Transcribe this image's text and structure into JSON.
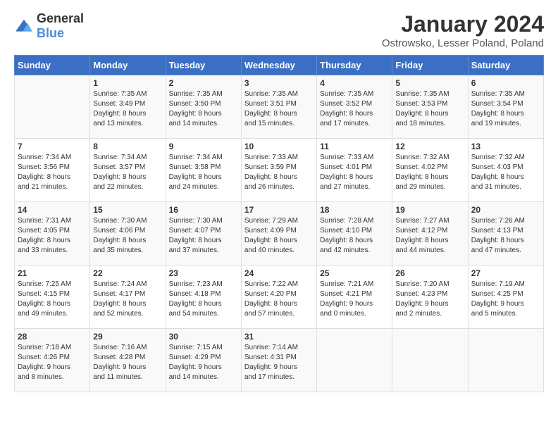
{
  "header": {
    "logo_general": "General",
    "logo_blue": "Blue",
    "title": "January 2024",
    "subtitle": "Ostrowsko, Lesser Poland, Poland"
  },
  "days_of_week": [
    "Sunday",
    "Monday",
    "Tuesday",
    "Wednesday",
    "Thursday",
    "Friday",
    "Saturday"
  ],
  "weeks": [
    [
      {
        "day": "",
        "info": ""
      },
      {
        "day": "1",
        "info": "Sunrise: 7:35 AM\nSunset: 3:49 PM\nDaylight: 8 hours\nand 13 minutes."
      },
      {
        "day": "2",
        "info": "Sunrise: 7:35 AM\nSunset: 3:50 PM\nDaylight: 8 hours\nand 14 minutes."
      },
      {
        "day": "3",
        "info": "Sunrise: 7:35 AM\nSunset: 3:51 PM\nDaylight: 8 hours\nand 15 minutes."
      },
      {
        "day": "4",
        "info": "Sunrise: 7:35 AM\nSunset: 3:52 PM\nDaylight: 8 hours\nand 17 minutes."
      },
      {
        "day": "5",
        "info": "Sunrise: 7:35 AM\nSunset: 3:53 PM\nDaylight: 8 hours\nand 18 minutes."
      },
      {
        "day": "6",
        "info": "Sunrise: 7:35 AM\nSunset: 3:54 PM\nDaylight: 8 hours\nand 19 minutes."
      }
    ],
    [
      {
        "day": "7",
        "info": "Sunrise: 7:34 AM\nSunset: 3:56 PM\nDaylight: 8 hours\nand 21 minutes."
      },
      {
        "day": "8",
        "info": "Sunrise: 7:34 AM\nSunset: 3:57 PM\nDaylight: 8 hours\nand 22 minutes."
      },
      {
        "day": "9",
        "info": "Sunrise: 7:34 AM\nSunset: 3:58 PM\nDaylight: 8 hours\nand 24 minutes."
      },
      {
        "day": "10",
        "info": "Sunrise: 7:33 AM\nSunset: 3:59 PM\nDaylight: 8 hours\nand 26 minutes."
      },
      {
        "day": "11",
        "info": "Sunrise: 7:33 AM\nSunset: 4:01 PM\nDaylight: 8 hours\nand 27 minutes."
      },
      {
        "day": "12",
        "info": "Sunrise: 7:32 AM\nSunset: 4:02 PM\nDaylight: 8 hours\nand 29 minutes."
      },
      {
        "day": "13",
        "info": "Sunrise: 7:32 AM\nSunset: 4:03 PM\nDaylight: 8 hours\nand 31 minutes."
      }
    ],
    [
      {
        "day": "14",
        "info": "Sunrise: 7:31 AM\nSunset: 4:05 PM\nDaylight: 8 hours\nand 33 minutes."
      },
      {
        "day": "15",
        "info": "Sunrise: 7:30 AM\nSunset: 4:06 PM\nDaylight: 8 hours\nand 35 minutes."
      },
      {
        "day": "16",
        "info": "Sunrise: 7:30 AM\nSunset: 4:07 PM\nDaylight: 8 hours\nand 37 minutes."
      },
      {
        "day": "17",
        "info": "Sunrise: 7:29 AM\nSunset: 4:09 PM\nDaylight: 8 hours\nand 40 minutes."
      },
      {
        "day": "18",
        "info": "Sunrise: 7:28 AM\nSunset: 4:10 PM\nDaylight: 8 hours\nand 42 minutes."
      },
      {
        "day": "19",
        "info": "Sunrise: 7:27 AM\nSunset: 4:12 PM\nDaylight: 8 hours\nand 44 minutes."
      },
      {
        "day": "20",
        "info": "Sunrise: 7:26 AM\nSunset: 4:13 PM\nDaylight: 8 hours\nand 47 minutes."
      }
    ],
    [
      {
        "day": "21",
        "info": "Sunrise: 7:25 AM\nSunset: 4:15 PM\nDaylight: 8 hours\nand 49 minutes."
      },
      {
        "day": "22",
        "info": "Sunrise: 7:24 AM\nSunset: 4:17 PM\nDaylight: 8 hours\nand 52 minutes."
      },
      {
        "day": "23",
        "info": "Sunrise: 7:23 AM\nSunset: 4:18 PM\nDaylight: 8 hours\nand 54 minutes."
      },
      {
        "day": "24",
        "info": "Sunrise: 7:22 AM\nSunset: 4:20 PM\nDaylight: 8 hours\nand 57 minutes."
      },
      {
        "day": "25",
        "info": "Sunrise: 7:21 AM\nSunset: 4:21 PM\nDaylight: 9 hours\nand 0 minutes."
      },
      {
        "day": "26",
        "info": "Sunrise: 7:20 AM\nSunset: 4:23 PM\nDaylight: 9 hours\nand 2 minutes."
      },
      {
        "day": "27",
        "info": "Sunrise: 7:19 AM\nSunset: 4:25 PM\nDaylight: 9 hours\nand 5 minutes."
      }
    ],
    [
      {
        "day": "28",
        "info": "Sunrise: 7:18 AM\nSunset: 4:26 PM\nDaylight: 9 hours\nand 8 minutes."
      },
      {
        "day": "29",
        "info": "Sunrise: 7:16 AM\nSunset: 4:28 PM\nDaylight: 9 hours\nand 11 minutes."
      },
      {
        "day": "30",
        "info": "Sunrise: 7:15 AM\nSunset: 4:29 PM\nDaylight: 9 hours\nand 14 minutes."
      },
      {
        "day": "31",
        "info": "Sunrise: 7:14 AM\nSunset: 4:31 PM\nDaylight: 9 hours\nand 17 minutes."
      },
      {
        "day": "",
        "info": ""
      },
      {
        "day": "",
        "info": ""
      },
      {
        "day": "",
        "info": ""
      }
    ]
  ]
}
